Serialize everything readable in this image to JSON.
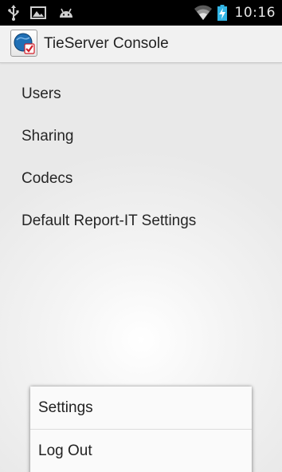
{
  "status_bar": {
    "icons_left": [
      "usb-icon",
      "picture-icon",
      "android-icon"
    ],
    "icons_right": [
      "wifi-icon",
      "battery-charging-icon"
    ],
    "time": "10:16"
  },
  "action_bar": {
    "app_icon": "tieserver-app-icon",
    "title": "TieServer Console"
  },
  "menu": {
    "items": [
      {
        "label": "Users"
      },
      {
        "label": "Sharing"
      },
      {
        "label": "Codecs"
      },
      {
        "label": "Default Report-IT Settings"
      }
    ]
  },
  "popup_menu": {
    "items": [
      {
        "label": "Settings"
      },
      {
        "label": "Log Out"
      }
    ]
  },
  "colors": {
    "status_bar_bg": "#000000",
    "action_bar_bg": "#f1f1f1",
    "text": "#262626",
    "battery_accent": "#33b5e5"
  }
}
